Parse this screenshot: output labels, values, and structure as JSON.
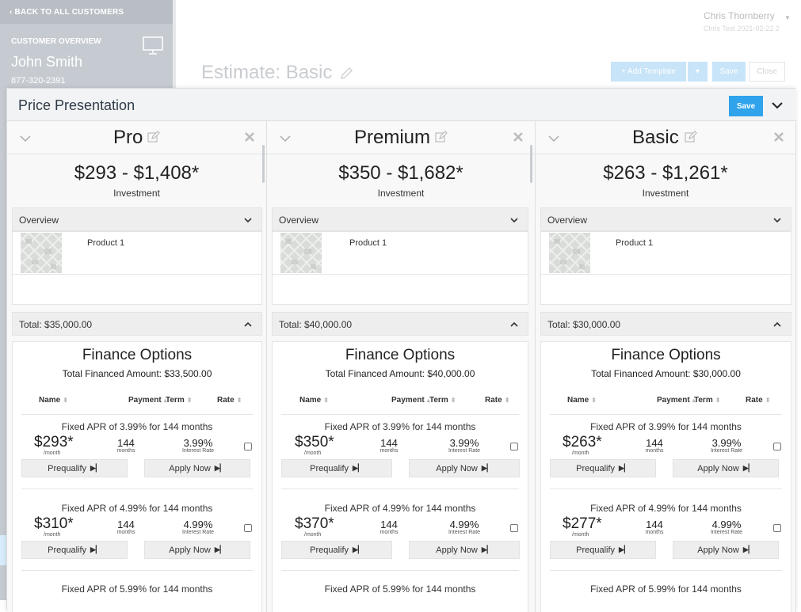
{
  "background": {
    "back_link": "‹ BACK TO ALL CUSTOMERS",
    "customer_label": "CUSTOMER OVERVIEW",
    "customer_name": "John Smith",
    "customer_phone": "877-320-2391",
    "user_name": "Chris Thornberry",
    "user_sub": "Chris Test 2021-02-22 2",
    "estimate_title": "Estimate:  Basic",
    "add_template": "+ Add Template",
    "save": "Save",
    "close": "Close"
  },
  "modal": {
    "title": "Price Presentation",
    "save": "Save"
  },
  "labels": {
    "investment": "Investment",
    "overview": "Overview",
    "finance_options": "Finance Options",
    "col_name": "Name",
    "col_payment": "Payment",
    "col_term": "Term",
    "col_rate": "Rate",
    "month": "/month",
    "months": "months",
    "interest_rate": "Interest Rate",
    "prequalify": "Prequalify",
    "apply_now": "Apply Now"
  },
  "packages": [
    {
      "name": "Pro",
      "price_range": "$293 - $1,408*",
      "product": "Product 1",
      "total": "Total: $35,000.00",
      "financed": "Total Financed Amount: $33,500.00",
      "options": [
        {
          "title": "Fixed APR of 3.99% for 144 months",
          "payment": "$293*",
          "term": "144",
          "rate": "3.99%"
        },
        {
          "title": "Fixed APR of 4.99% for 144 months",
          "payment": "$310*",
          "term": "144",
          "rate": "4.99%"
        },
        {
          "title": "Fixed APR of 5.99% for 144 months"
        }
      ]
    },
    {
      "name": "Premium",
      "price_range": "$350 - $1,682*",
      "product": "Product 1",
      "total": "Total: $40,000.00",
      "financed": "Total Financed Amount: $40,000.00",
      "options": [
        {
          "title": "Fixed APR of 3.99% for 144 months",
          "payment": "$350*",
          "term": "144",
          "rate": "3.99%"
        },
        {
          "title": "Fixed APR of 4.99% for 144 months",
          "payment": "$370*",
          "term": "144",
          "rate": "4.99%"
        },
        {
          "title": "Fixed APR of 5.99% for 144 months"
        }
      ]
    },
    {
      "name": "Basic",
      "price_range": "$263 - $1,261*",
      "product": "Product 1",
      "total": "Total: $30,000.00",
      "financed": "Total Financed Amount: $30,000.00",
      "options": [
        {
          "title": "Fixed APR of 3.99% for 144 months",
          "payment": "$263*",
          "term": "144",
          "rate": "3.99%"
        },
        {
          "title": "Fixed APR of 4.99% for 144 months",
          "payment": "$277*",
          "term": "144",
          "rate": "4.99%"
        },
        {
          "title": "Fixed APR of 5.99% for 144 months"
        }
      ]
    }
  ],
  "colors": {
    "accent": "#2fa3ec",
    "sidebar": "#c6cbd1"
  }
}
